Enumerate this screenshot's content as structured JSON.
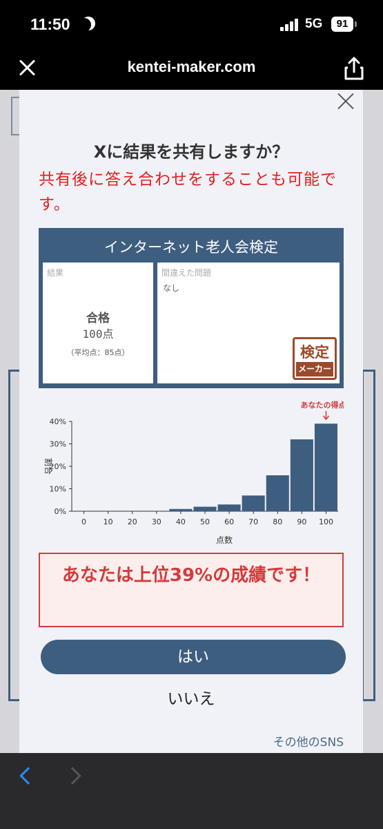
{
  "status": {
    "time": "11:50",
    "network": "5G",
    "battery": "91"
  },
  "browser": {
    "url": "kentei-maker.com"
  },
  "modal": {
    "title": "Xに結果を共有しますか？",
    "note": "共有後に答え合わせをすることも可能です。",
    "certificate": {
      "title": "インターネット老人会検定",
      "result_label": "結果",
      "pass": "合格",
      "score": "100点",
      "average": "（平均点：85点）",
      "mistakes_label": "間違えた問題",
      "mistakes_value": "なし",
      "stamp_line1": "検定",
      "stamp_line2": "メーカー"
    },
    "rank_text": "あなたは上位39%の成績です！",
    "yes_label": "はい",
    "no_label": "いいえ",
    "other_sns_label": "その他のSNS"
  },
  "chart_data": {
    "type": "bar",
    "categories": [
      "0",
      "10",
      "20",
      "30",
      "40",
      "50",
      "60",
      "70",
      "80",
      "90",
      "100"
    ],
    "values": [
      0,
      0,
      0,
      0,
      1,
      2,
      3,
      7,
      16,
      32,
      39
    ],
    "xlabel": "点数",
    "ylabel": "割合",
    "yticks": [
      "0%",
      "10%",
      "20%",
      "30%",
      "40%"
    ],
    "ylim": [
      0,
      40
    ],
    "annotation": "あなたの得点",
    "bar_color": "#3e5e80"
  },
  "colors": {
    "accent": "#3e5e80",
    "alert": "#e02020"
  }
}
